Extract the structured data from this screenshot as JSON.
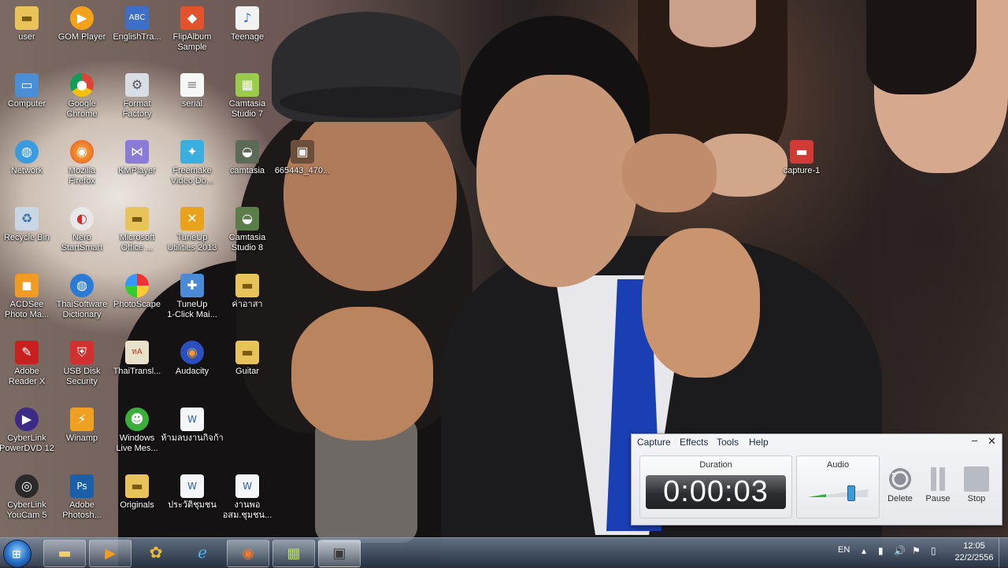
{
  "desktop": {
    "icons": [
      {
        "label": "user",
        "icon": "folder-icon"
      },
      {
        "label": "GOM Player",
        "icon": "gom-player-icon"
      },
      {
        "label": "EnglishTra...",
        "icon": "abc-dictionary-icon"
      },
      {
        "label": "FlipAlbum\nSample",
        "icon": "flipalbum-icon"
      },
      {
        "label": "Teenage",
        "icon": "mp3-file-icon"
      },
      {
        "label": "Computer",
        "icon": "computer-icon"
      },
      {
        "label": "Google\nChrome",
        "icon": "chrome-icon"
      },
      {
        "label": "Format\nFactory",
        "icon": "format-factory-icon"
      },
      {
        "label": "serial",
        "icon": "text-file-icon"
      },
      {
        "label": "Camtasia\nStudio 7",
        "icon": "camtasia-icon"
      },
      {
        "label": "Network",
        "icon": "network-icon"
      },
      {
        "label": "Mozilla\nFirefox",
        "icon": "firefox-icon"
      },
      {
        "label": "KMPlayer",
        "icon": "kmplayer-icon"
      },
      {
        "label": "Freemake\nVideo Do...",
        "icon": "freemake-icon"
      },
      {
        "label": "camtasia",
        "icon": "camtasia-shortcut-icon"
      },
      {
        "label": "665443_470...",
        "icon": "image-file-icon"
      },
      {
        "label": "capture-1",
        "icon": "capture-file-icon"
      },
      {
        "label": "Recycle Bin",
        "icon": "recycle-bin-icon"
      },
      {
        "label": "Nero\nStartSmart",
        "icon": "nero-icon"
      },
      {
        "label": "Microsoft\nOffice ...",
        "icon": "office-folder-icon"
      },
      {
        "label": "TuneUp\nUtilities 2013",
        "icon": "tuneup-icon"
      },
      {
        "label": "Camtasia\nStudio 8",
        "icon": "camtasia-8-icon"
      },
      {
        "label": "ACDSee\nPhoto Ma...",
        "icon": "acdsee-icon"
      },
      {
        "label": "ThaiSoftware\nDictionary",
        "icon": "globe-icon"
      },
      {
        "label": "PhotoScape",
        "icon": "photoscape-icon"
      },
      {
        "label": "TuneUp\n1-Click Mai...",
        "icon": "tuneup-1click-icon"
      },
      {
        "label": "ค่าอาสา",
        "icon": "folder-icon"
      },
      {
        "label": "Adobe\nReader X",
        "icon": "adobe-reader-icon"
      },
      {
        "label": "USB Disk\nSecurity",
        "icon": "shield-icon"
      },
      {
        "label": "ThaiTransl...",
        "icon": "thai-translator-icon"
      },
      {
        "label": "Audacity",
        "icon": "audacity-icon"
      },
      {
        "label": "Guitar",
        "icon": "folder-icon"
      },
      {
        "label": "CyberLink\nPowerDVD 12",
        "icon": "powerdvd-icon"
      },
      {
        "label": "Winamp",
        "icon": "winamp-icon"
      },
      {
        "label": "Windows\nLive Mes...",
        "icon": "messenger-icon"
      },
      {
        "label": "ห้ามลบงานกิจก้า",
        "icon": "word-document-icon"
      },
      {
        "label": "CyberLink\nYouCam 5",
        "icon": "youcam-icon"
      },
      {
        "label": "Adobe\nPhotosh...",
        "icon": "photoshop-icon"
      },
      {
        "label": "Originals",
        "icon": "folder-icon"
      },
      {
        "label": "ประวัติชุมชน",
        "icon": "word-document-icon"
      },
      {
        "label": "งานพอ\nอสม.ชุมชน...",
        "icon": "word-document-icon"
      }
    ]
  },
  "recorder": {
    "menu": [
      "Capture",
      "Effects",
      "Tools",
      "Help"
    ],
    "minimize_symbol": "–",
    "close_symbol": "✕",
    "duration_label": "Duration",
    "duration_value": "0:00:03",
    "audio_label": "Audio",
    "audio_level": 0.3,
    "delete_label": "Delete",
    "pause_label": "Pause",
    "stop_label": "Stop"
  },
  "taskbar": {
    "apps": [
      {
        "name": "windows-explorer",
        "icon": "folder-icon"
      },
      {
        "name": "media-player",
        "icon": "play-icon"
      },
      {
        "name": "paint-app",
        "icon": "paint-icon"
      },
      {
        "name": "internet-explorer",
        "icon": "ie-icon"
      },
      {
        "name": "firefox",
        "icon": "firefox-icon"
      },
      {
        "name": "camtasia-studio",
        "icon": "camtasia-icon"
      },
      {
        "name": "camtasia-recorder",
        "icon": "recorder-icon"
      }
    ],
    "language": "EN",
    "clock_time": "12:05",
    "clock_date": "22/2/2556"
  }
}
